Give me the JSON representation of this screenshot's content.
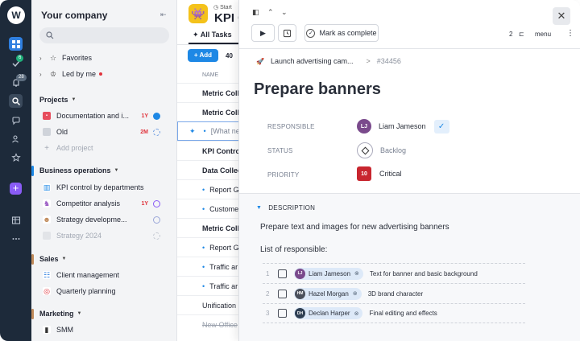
{
  "rail": {
    "logo": "W",
    "badge_tasks": "6",
    "badge_notifications": "28",
    "add_symbol": "+",
    "icons": [
      "grid-icon",
      "check-icon",
      "bell-icon",
      "search-icon",
      "chat-icon",
      "users-icon",
      "star-icon",
      "plus-icon",
      "table-icon",
      "more-icon"
    ]
  },
  "sidebar": {
    "title": "Your company",
    "collapse_symbol": "⇤",
    "favorites": "Favorites",
    "led_by_me": "Led by me",
    "sections": [
      {
        "title": "Projects",
        "color": "#c7ccd4",
        "items": [
          {
            "label": "Documentation and i...",
            "due": "1Y",
            "icon_color": "#e74c5c"
          },
          {
            "label": "Old",
            "due": "2M",
            "icon_color": "#cfd3da"
          },
          {
            "label": "Add project"
          }
        ]
      },
      {
        "title": "Business operations",
        "color": "#1e88e5",
        "items": [
          {
            "label": "KPI control by departments"
          },
          {
            "label": "Competitor analysis",
            "due": "1Y"
          },
          {
            "label": "Strategy developme..."
          },
          {
            "label": "Strategy 2024"
          }
        ]
      },
      {
        "title": "Sales",
        "color": "#c08a5a",
        "items": [
          {
            "label": "Client management"
          },
          {
            "label": "Quarterly planning"
          }
        ]
      },
      {
        "title": "Marketing",
        "color": "#c08a5a",
        "items": [
          {
            "label": "SMM"
          }
        ]
      }
    ]
  },
  "main": {
    "breadcrumb_start": "Start",
    "project_title": "KPI C",
    "tab_all": "All Tasks",
    "add_label": "Add",
    "count": "40",
    "col_name": "NAME",
    "tasks": [
      {
        "label": "Metric Colle"
      },
      {
        "label": "Metric Colle"
      },
      {
        "label": "[What ne"
      },
      {
        "label": "KPI Control"
      },
      {
        "label": "Data Collec"
      },
      {
        "label": "Report G"
      },
      {
        "label": "Custome"
      },
      {
        "label": "Metric Colle"
      },
      {
        "label": "Report G"
      },
      {
        "label": "Traffic ar"
      },
      {
        "label": "Traffic ar"
      },
      {
        "label": "Unification"
      },
      {
        "label": "New Office"
      }
    ]
  },
  "panel": {
    "play_symbol": "▶",
    "mark_complete": "Mark as complete",
    "count": "2",
    "menu_label": "menu",
    "more_symbol": "⋮",
    "close_symbol": "✕",
    "parent_task": "Launch advertising cam...",
    "task_id": "#34456",
    "title": "Prepare banners",
    "fields": {
      "responsible_label": "RESPONSIBLE",
      "responsible_value": "Liam Jameson",
      "status_label": "STATUS",
      "status_value": "Backlog",
      "priority_label": "PRIORITY",
      "priority_badge": "10",
      "priority_value": "Critical"
    },
    "description": {
      "header": "DESCRIPTION",
      "text": "Prepare text and images for new advertising banners",
      "list_title": "List of responsible:",
      "rows": [
        {
          "num": "1",
          "person": "Liam Jameson",
          "task": "Text for banner and basic background",
          "avatar_color": "#7a4a8c"
        },
        {
          "num": "2",
          "person": "Hazel Morgan",
          "task": "3D brand character",
          "avatar_color": "#4a4f5a"
        },
        {
          "num": "3",
          "person": "Declan Harper",
          "task": "Final editing and effects",
          "avatar_color": "#2e3e52"
        }
      ]
    }
  }
}
